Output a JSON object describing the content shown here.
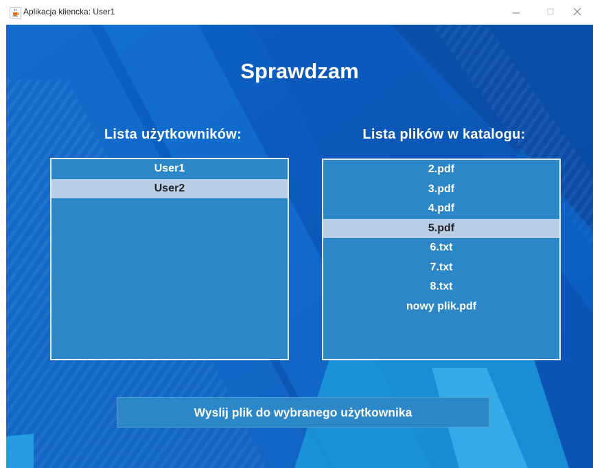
{
  "window": {
    "title": "Aplikacja kliencka: User1",
    "icons": {
      "app": "java-cup-icon",
      "minimize": "minimize-icon",
      "maximize": "maximize-icon",
      "close": "close-icon"
    }
  },
  "colors": {
    "background": "#0a5cc0",
    "list_background": "#2b87c7",
    "selected_item": "#b8cde6",
    "text": "#ffffff"
  },
  "main": {
    "heading": "Sprawdzam",
    "users_label": "Lista użytkowników:",
    "files_label": "Lista plików w katalogu:",
    "users": [
      {
        "label": "User1",
        "selected": false
      },
      {
        "label": "User2",
        "selected": true
      }
    ],
    "files": [
      {
        "label": "2.pdf",
        "selected": false
      },
      {
        "label": "3.pdf",
        "selected": false
      },
      {
        "label": "4.pdf",
        "selected": false
      },
      {
        "label": "5.pdf",
        "selected": true
      },
      {
        "label": "6.txt",
        "selected": false
      },
      {
        "label": "7.txt",
        "selected": false
      },
      {
        "label": "8.txt",
        "selected": false
      },
      {
        "label": "nowy plik.pdf",
        "selected": false
      }
    ],
    "send_button": "Wyslij plik do wybranego użytkownika"
  }
}
